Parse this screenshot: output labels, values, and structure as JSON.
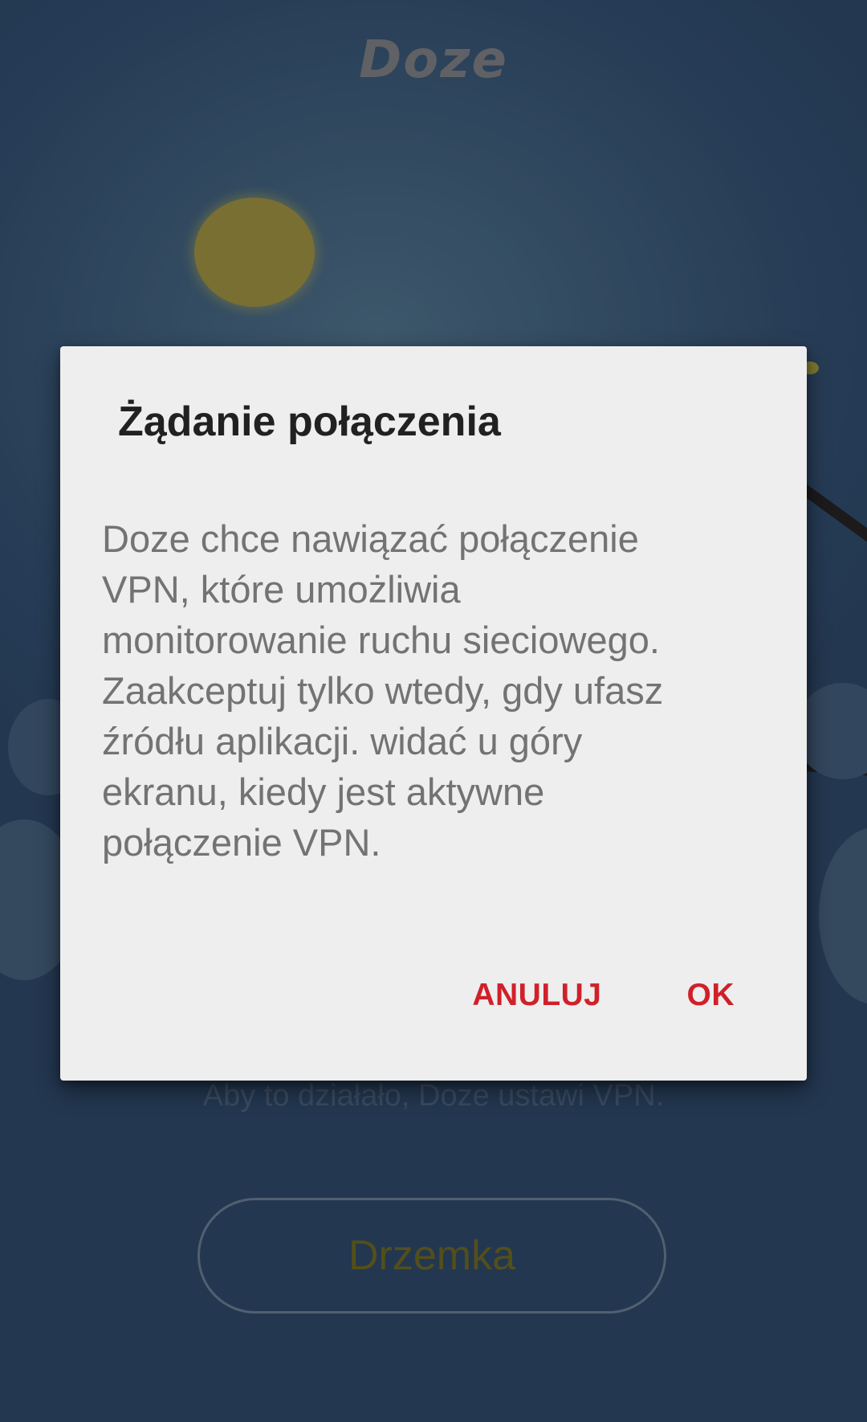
{
  "app": {
    "title": "Doze",
    "info_text": "Aby to działało, Doze ustawi VPN.",
    "doze_button_label": "Drzemka"
  },
  "dialog": {
    "title": "Żądanie połączenia",
    "message_lines": [
      "Doze chce nawiązać połączenie",
      "VPN, które umożliwia",
      "monitorowanie ruchu sieciowego.",
      "Zaakceptuj tylko wtedy, gdy ufasz",
      "źródłu aplikacji. widać u góry",
      "ekranu, kiedy jest aktywne",
      "połączenie VPN."
    ],
    "cancel_label": "ANULUJ",
    "ok_label": "OK"
  },
  "colors": {
    "accent": "#d0202a",
    "dialog_background": "#eeeeee",
    "sky": "#2c4563",
    "sun": "#8a7f3a"
  },
  "icons": {
    "sun": "sun-icon",
    "branch": "branch-decoration"
  }
}
